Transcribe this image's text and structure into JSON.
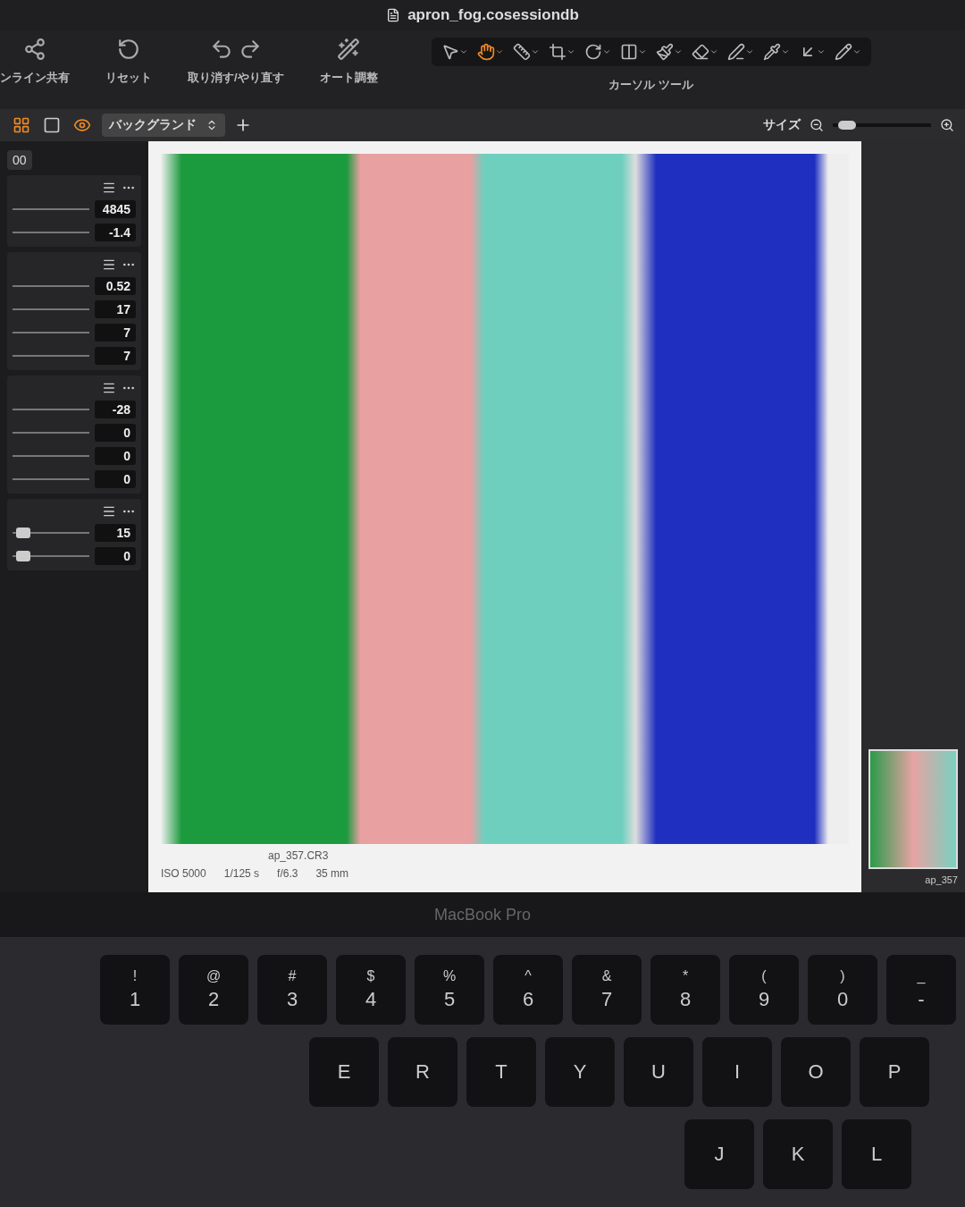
{
  "window": {
    "title": "apron_fog.cosessiondb"
  },
  "toolbar": {
    "groups": [
      {
        "label": "ンライン共有"
      },
      {
        "label": "リセット"
      },
      {
        "label": "取り消す/やり直す"
      },
      {
        "label": "オート調整"
      }
    ],
    "cursor_tools": {
      "label": "カーソル ツール",
      "tools": [
        {
          "selected": false
        },
        {
          "selected": true
        },
        {
          "selected": false
        },
        {
          "selected": false
        },
        {
          "selected": false
        },
        {
          "selected": false
        },
        {
          "selected": false
        },
        {
          "selected": false
        },
        {
          "selected": false
        },
        {
          "selected": false
        },
        {
          "selected": false
        },
        {
          "selected": false
        }
      ]
    }
  },
  "view_bar": {
    "modes": [
      {
        "selected": true
      },
      {
        "selected": false
      },
      {
        "selected": true
      }
    ],
    "background": "バックグランド",
    "size_label": "サイズ",
    "size_slider": {
      "level": 0.05
    }
  },
  "left_panel": {
    "partial_value": "00",
    "sections": [
      {
        "rows": [
          {
            "value": "4845"
          },
          {
            "value": "-1.4"
          }
        ]
      },
      {
        "rows": [
          {
            "value": "0.52"
          },
          {
            "value": "17"
          },
          {
            "value": "7"
          },
          {
            "value": "7"
          }
        ]
      },
      {
        "rows": [
          {
            "value": "-28"
          },
          {
            "value": "0"
          },
          {
            "value": "0"
          },
          {
            "value": "0"
          }
        ]
      },
      {
        "rows": [
          {
            "value": "15",
            "level": 0.06
          },
          {
            "value": "0",
            "level": 0.06
          }
        ]
      }
    ]
  },
  "viewer": {
    "filename": "ap_357.CR3",
    "exif": [
      "ISO 5000",
      "1/125 s",
      "f/6.3",
      "35 mm"
    ]
  },
  "filmstrip": {
    "caption": "ap_357"
  },
  "bezel": {
    "label": "MacBook Pro"
  },
  "keyboard": {
    "rows": [
      [
        {
          "upper": "!",
          "lower": "1"
        },
        {
          "upper": "@",
          "lower": "2"
        },
        {
          "upper": "#",
          "lower": "3"
        },
        {
          "upper": "$",
          "lower": "4"
        },
        {
          "upper": "%",
          "lower": "5"
        },
        {
          "upper": "^",
          "lower": "6"
        },
        {
          "upper": "&",
          "lower": "7"
        },
        {
          "upper": "*",
          "lower": "8"
        },
        {
          "upper": "(",
          "lower": "9"
        },
        {
          "upper": ")",
          "lower": "0"
        },
        {
          "upper": "_",
          "lower": "-"
        }
      ],
      [
        {
          "lower": "E"
        },
        {
          "lower": "R"
        },
        {
          "lower": "T"
        },
        {
          "lower": "Y"
        },
        {
          "lower": "U"
        },
        {
          "lower": "I"
        },
        {
          "lower": "O"
        },
        {
          "lower": "P"
        }
      ],
      [
        {
          "lower": "J"
        },
        {
          "lower": "K"
        },
        {
          "lower": "L"
        }
      ]
    ]
  }
}
